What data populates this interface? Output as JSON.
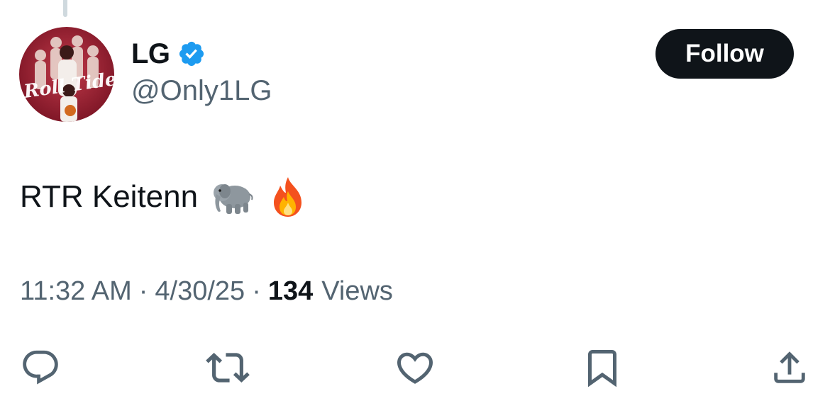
{
  "tweet": {
    "author": {
      "display_name": "LG",
      "handle": "@Only1LG",
      "verified": true,
      "avatar_text": "Roll Tide"
    },
    "follow_label": "Follow",
    "text": "RTR Keitenn",
    "emojis": [
      "elephant-emoji",
      "fire-emoji"
    ],
    "time": "11:32 AM",
    "date": "4/30/25",
    "separator": "·",
    "views_count": "134",
    "views_label": "Views"
  },
  "actions": [
    {
      "name": "reply",
      "icon": "reply-icon"
    },
    {
      "name": "retweet",
      "icon": "retweet-icon"
    },
    {
      "name": "like",
      "icon": "heart-icon"
    },
    {
      "name": "bookmark",
      "icon": "bookmark-icon"
    },
    {
      "name": "share",
      "icon": "share-icon"
    }
  ],
  "colors": {
    "text_primary": "#0f1419",
    "text_secondary": "#536471",
    "verified_blue": "#1d9bf0",
    "follow_bg": "#0f1419",
    "avatar_crimson": "#9e1b32"
  }
}
